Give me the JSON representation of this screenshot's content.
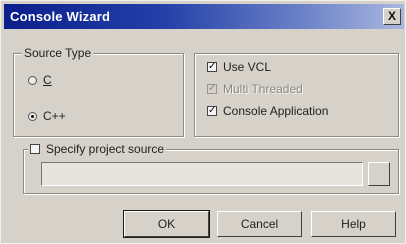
{
  "window": {
    "title": "Console Wizard",
    "close_label": "X"
  },
  "source_type": {
    "legend": "Source Type",
    "options": [
      {
        "label": "C",
        "underline_char": "C",
        "selected": false
      },
      {
        "label": "C++",
        "selected": true
      }
    ]
  },
  "options": {
    "use_vcl": {
      "label": "Use VCL",
      "checked": true,
      "enabled": true
    },
    "multi_threaded": {
      "label": "Multi Threaded",
      "checked": true,
      "enabled": false
    },
    "console_application": {
      "label": "Console Application",
      "checked": true,
      "enabled": true
    }
  },
  "project_source": {
    "label": "Specify project source",
    "checked": false,
    "value": ""
  },
  "buttons": {
    "ok": "OK",
    "cancel": "Cancel",
    "help": "Help"
  }
}
